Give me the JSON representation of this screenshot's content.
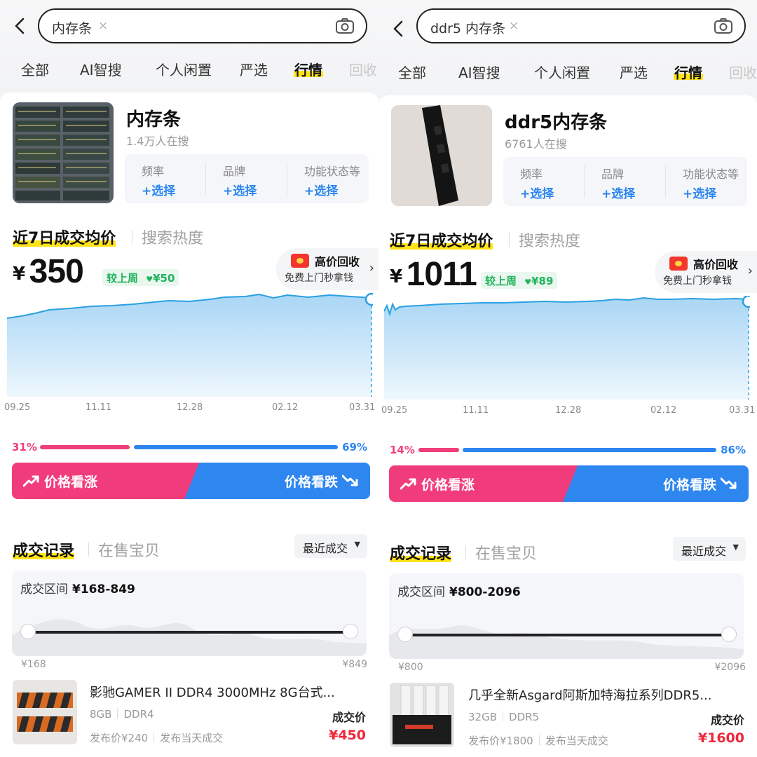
{
  "panels": [
    {
      "search": {
        "query": "内存条",
        "clear": "×"
      },
      "tabs": [
        "全部",
        "AI智搜",
        "个人闲置",
        "严选",
        "行情",
        "回收"
      ],
      "active_tab": "行情",
      "product": {
        "title": "内存条",
        "searching": "1.4万人在搜"
      },
      "filters": [
        {
          "label": "频率",
          "select": "+选择"
        },
        {
          "label": "品牌",
          "select": "+选择"
        },
        {
          "label": "功能状态等",
          "select": "+选择"
        }
      ],
      "section_tabs": [
        "近7日成交均价",
        "搜索热度"
      ],
      "price": {
        "currency": "¥",
        "value": "350"
      },
      "delta": {
        "label": "较上周",
        "arrow": "♥",
        "value": "¥50"
      },
      "recycle": {
        "title": "高价回收",
        "subtitle": "免费上门秒拿钱",
        "arrow": "›"
      },
      "x_ticks": [
        "09.25",
        "11.11",
        "12.28",
        "02.12",
        "03.31"
      ],
      "sentiment": {
        "up_pct": "31%",
        "down_pct": "69%",
        "up_value": 31,
        "down_value": 69,
        "up_label": "价格看涨",
        "down_label": "价格看跌"
      },
      "record_tabs": [
        "成交记录",
        "在售宝贝"
      ],
      "sort": {
        "label": "最近成交",
        "caret": "▼"
      },
      "range": {
        "label": "成交区间",
        "value": "¥168-849",
        "min": "¥168",
        "max": "¥849"
      },
      "item": {
        "title": "影驰GAMER II DDR4 3000MHz 8G台式...",
        "tags": [
          "8GB",
          "DDR4"
        ],
        "meta": [
          "发布价¥240",
          "发布当天成交"
        ],
        "deal_label": "成交价",
        "deal_price": "¥450"
      }
    },
    {
      "search": {
        "query": "ddr5 内存条",
        "clear": "×"
      },
      "tabs": [
        "全部",
        "AI智搜",
        "个人闲置",
        "严选",
        "行情",
        "回收"
      ],
      "active_tab": "行情",
      "product": {
        "title": "ddr5内存条",
        "searching": "6761人在搜"
      },
      "filters": [
        {
          "label": "频率",
          "select": "+选择"
        },
        {
          "label": "品牌",
          "select": "+选择"
        },
        {
          "label": "功能状态等",
          "select": "+选择"
        }
      ],
      "section_tabs": [
        "近7日成交均价",
        "搜索热度"
      ],
      "price": {
        "currency": "¥",
        "value": "1011"
      },
      "delta": {
        "label": "较上周",
        "arrow": "♥",
        "value": "¥89"
      },
      "recycle": {
        "title": "高价回收",
        "subtitle": "免费上门秒拿钱",
        "arrow": "›"
      },
      "x_ticks": [
        "09.25",
        "11.11",
        "12.28",
        "02.12",
        "03.31"
      ],
      "sentiment": {
        "up_pct": "14%",
        "down_pct": "86%",
        "up_value": 14,
        "down_value": 86,
        "up_label": "价格看涨",
        "down_label": "价格看跌"
      },
      "record_tabs": [
        "成交记录",
        "在售宝贝"
      ],
      "sort": {
        "label": "最近成交",
        "caret": "▼"
      },
      "range": {
        "label": "成交区间",
        "value": "¥800-2096",
        "min": "¥800",
        "max": "¥2096"
      },
      "item": {
        "title": "几乎全新Asgard阿斯加特海拉系列DDR5...",
        "tags": [
          "32GB",
          "DDR5"
        ],
        "meta": [
          "发布价¥1800",
          "发布当天成交"
        ],
        "deal_label": "成交价",
        "deal_price": "¥1600"
      }
    }
  ],
  "colors": {
    "accent_blue": "#2d86ef",
    "accent_pink": "#f13c7c",
    "highlight_yellow": "#ffe31a",
    "price_red": "#f0263a",
    "up_green": "#21b45c"
  },
  "icons": [
    "back-icon",
    "clear-icon",
    "camera-icon",
    "red-envelope-icon",
    "chevron-right-icon",
    "trend-up-icon",
    "trend-down-icon",
    "caret-down-icon"
  ]
}
